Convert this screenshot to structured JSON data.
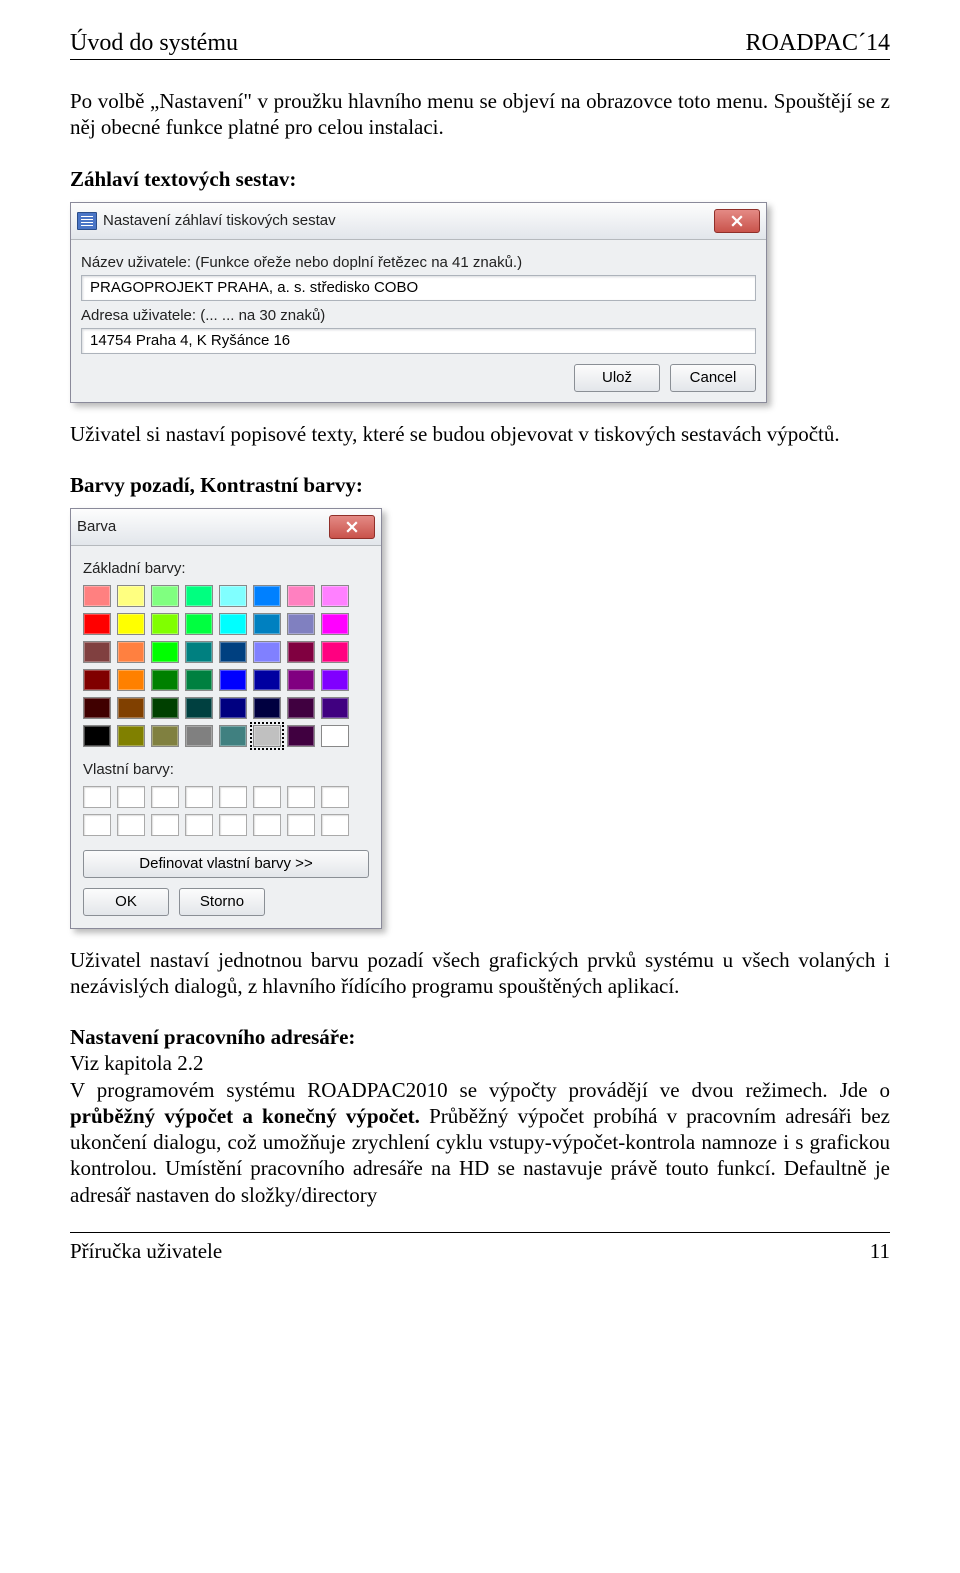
{
  "header": {
    "left": "Úvod do systému",
    "right": "ROADPAC´14"
  },
  "para1": "Po volbě „Nastavení\" v proužku hlavního menu se objeví na obrazovce toto menu. Spouštějí se z něj obecné funkce platné pro celou instalaci.",
  "heading_zahlavi": "Záhlaví textových sestav:",
  "dialog1": {
    "title": "Nastavení záhlaví tiskových sestav",
    "label_nazev": "Název uživatele: (Funkce ořeže nebo doplní řetězec na 41 znaků.)",
    "value_nazev": "PRAGOPROJEKT PRAHA, a. s. středisko COBO",
    "label_adresa": "Adresa uživatele: (... ... na 30 znaků)",
    "value_adresa": "14754 Praha 4, K Ryšánce 16",
    "btn_uloz": "Ulož",
    "btn_cancel": "Cancel"
  },
  "para2": "Uživatel si nastaví popisové texty, které se budou objevovat v  tiskových sestavách výpočtů.",
  "heading_barvy": "Barvy pozadí, Kontrastní barvy:",
  "color_dialog": {
    "title": "Barva",
    "label_zakladni": "Základní barvy:",
    "label_vlastni": "Vlastní barvy:",
    "btn_define": "Definovat vlastní barvy >>",
    "btn_ok": "OK",
    "btn_storno": "Storno",
    "basic_colors": [
      "#ff8080",
      "#ffff80",
      "#80ff80",
      "#00ff80",
      "#80ffff",
      "#0080ff",
      "#ff80c0",
      "#ff80ff",
      "#ff0000",
      "#ffff00",
      "#80ff00",
      "#00ff40",
      "#00ffff",
      "#0080c0",
      "#8080c0",
      "#ff00ff",
      "#804040",
      "#ff8040",
      "#00ff00",
      "#008080",
      "#004080",
      "#8080ff",
      "#800040",
      "#ff0080",
      "#800000",
      "#ff8000",
      "#008000",
      "#008040",
      "#0000ff",
      "#0000a0",
      "#800080",
      "#8000ff",
      "#400000",
      "#804000",
      "#004000",
      "#004040",
      "#000080",
      "#000040",
      "#400040",
      "#400080",
      "#000000",
      "#808000",
      "#808040",
      "#808080",
      "#408080",
      "#c0c0c0",
      "#400040",
      "#ffffff"
    ],
    "selected_index": 45
  },
  "para3": "Uživatel nastaví jednotnou barvu pozadí všech grafických prvků systému u všech volaných i nezávislých dialogů, z hlavního řídícího programu spouštěných aplikací.",
  "heading_nastaveni": "Nastavení pracovního adresáře:",
  "line_viz": "Viz kapitola 2.2",
  "para4_pre": "V programovém systému ROADPAC2010 se výpočty provádějí ve dvou režimech. Jde o ",
  "para4_bold": "průběžný výpočet a konečný výpočet.",
  "para4_post": " Průběžný výpočet probíhá v pracovním adresáři bez ukončení dialogu, což umožňuje zrychlení cyklu vstupy-výpočet-kontrola namnoze i s grafickou kontrolou. Umístění pracovního adresáře na HD se nastavuje právě touto funkcí. Defaultně je adresář nastaven do složky/directory",
  "footer": {
    "left": "Příručka uživatele",
    "right": "11"
  }
}
